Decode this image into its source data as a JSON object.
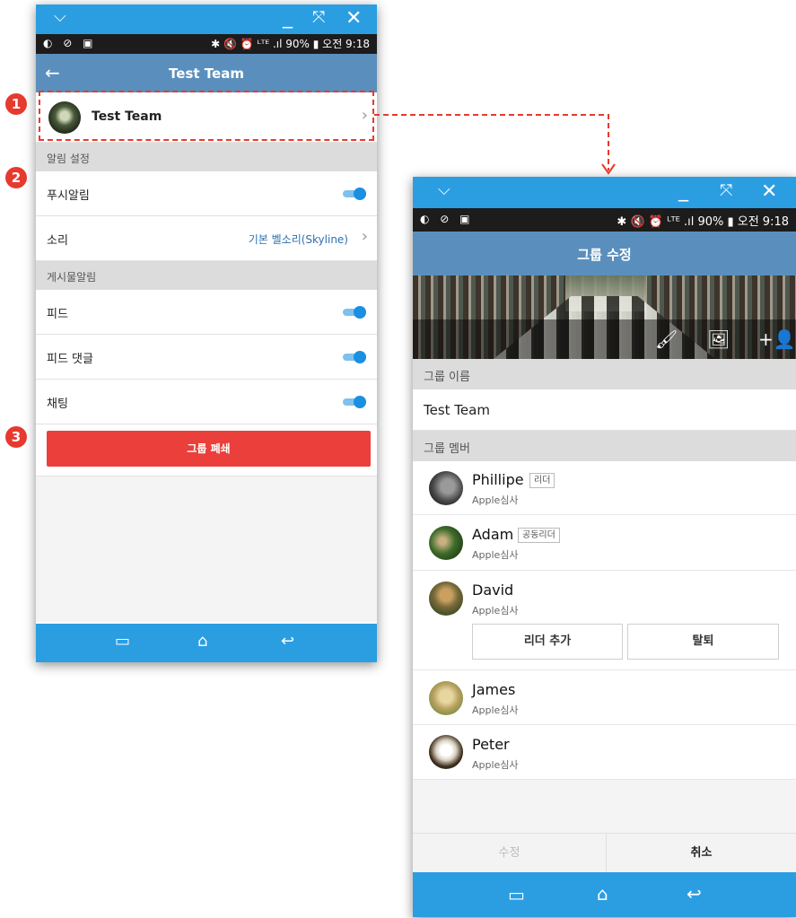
{
  "screen1": {
    "title": "Test Team",
    "status_right": "✱ 🔇 ⏰ ᴸᵀᴱ .ıl 90% ▮ 오전 9:18",
    "status_left": "◐ ⊘ ▣",
    "group_row": {
      "name": "Test Team"
    },
    "sections": {
      "notifications": "알림 설정",
      "post_notifications": "게시물알림"
    },
    "rows": {
      "push": "푸시알림",
      "sound": "소리",
      "sound_value": "기본 벨소리(Skyline)",
      "feed": "피드",
      "feed_comment": "피드 댓글",
      "chat": "채팅"
    },
    "toggles": {
      "push": true,
      "feed": true,
      "feed_comment": true,
      "chat": true
    },
    "delete_button": "그룹 폐쇄"
  },
  "screen2": {
    "title": "그룹 수정",
    "status_right": "✱ 🔇 ⏰ ᴸᵀᴱ .ıl 90% ▮ 오전 9:18",
    "status_left": "◐ ⊘ ▣",
    "group_name_label": "그룹 이름",
    "group_name_value": "Test Team",
    "members_label": "그룹 멤버",
    "members": [
      {
        "name": "Phillipe",
        "badge": "리더",
        "sub": "Apple심사"
      },
      {
        "name": "Adam",
        "badge": "공동리더",
        "sub": "Apple심사"
      },
      {
        "name": "David",
        "badge": "",
        "sub": "Apple심사"
      },
      {
        "name": "James",
        "badge": "",
        "sub": "Apple심사"
      },
      {
        "name": "Peter",
        "badge": "",
        "sub": "Apple심사"
      }
    ],
    "member_actions": {
      "add_leader": "리더 추가",
      "remove": "탈퇴"
    },
    "footer": {
      "edit": "수정",
      "cancel": "취소"
    }
  },
  "markers": [
    "1",
    "2",
    "3"
  ],
  "colors": {
    "window_bar": "#2b9ee2",
    "app_bar": "#5a8fbd",
    "danger": "#ea3f3a",
    "annotation": "#e63a2f",
    "toggle_on": "#1b8fe0"
  },
  "icons": [
    "chevron-down-icon",
    "minimize-icon",
    "expand-icon",
    "close-icon",
    "back-arrow-icon",
    "chevron-right-icon",
    "brush-icon",
    "image-icon",
    "add-person-icon",
    "recent-apps-icon",
    "home-icon",
    "back-icon"
  ]
}
